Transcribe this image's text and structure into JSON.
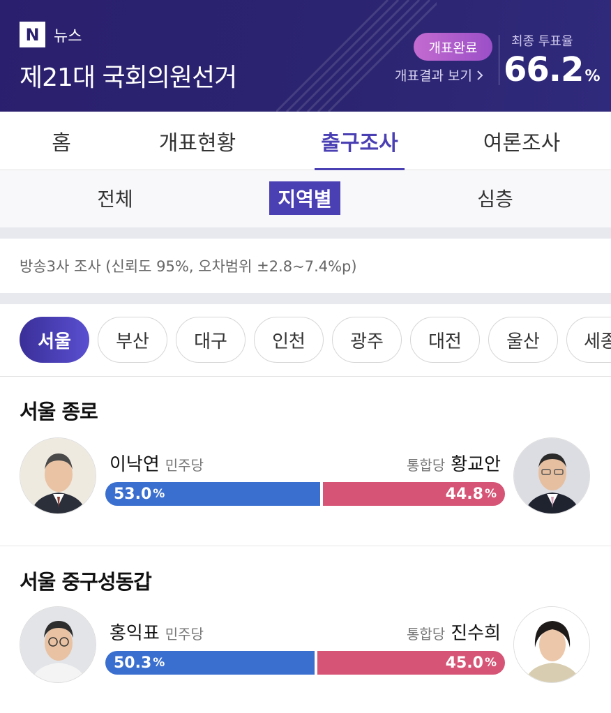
{
  "header": {
    "logo_letter": "N",
    "brand": "뉴스",
    "title": "제21대 국회의원선거",
    "status_pill": "개표완료",
    "view_results": "개표결과 보기",
    "turnout_label": "최종 투표율",
    "turnout_value": "66.2",
    "turnout_unit": "%"
  },
  "main_tabs": [
    {
      "label": "홈"
    },
    {
      "label": "개표현황"
    },
    {
      "label": "출구조사",
      "active": true
    },
    {
      "label": "여론조사"
    }
  ],
  "sub_tabs": [
    {
      "label": "전체"
    },
    {
      "label": "지역별",
      "active": true
    },
    {
      "label": "심층"
    }
  ],
  "survey_note": "방송3사 조사 (신뢰도 95%, 오차범위 ±2.8~7.4%p)",
  "regions": [
    "서울",
    "부산",
    "대구",
    "인천",
    "광주",
    "대전",
    "울산",
    "세종"
  ],
  "races": [
    {
      "title": "서울 종로",
      "left": {
        "name": "이낙연",
        "party": "민주당",
        "value": "53.0",
        "share": 53.0
      },
      "right": {
        "name": "황교안",
        "party": "통합당",
        "value": "44.8",
        "share": 44.8
      }
    },
    {
      "title": "서울 중구성동갑",
      "left": {
        "name": "홍익표",
        "party": "민주당",
        "value": "50.3",
        "share": 50.3
      },
      "right": {
        "name": "진수희",
        "party": "통합당",
        "value": "45.0",
        "share": 45.0
      }
    }
  ],
  "percent_sign": "%",
  "colors": {
    "header_bg": "#2a1f6e",
    "accent": "#4a3fb3",
    "left_party": "#3a6fcf",
    "right_party": "#d65475"
  }
}
